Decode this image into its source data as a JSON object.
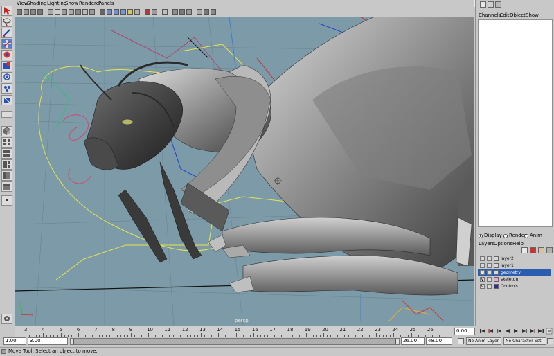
{
  "menubar": {
    "items": [
      "View",
      "Shading",
      "Lighting",
      "Show",
      "Renderer",
      "Panels"
    ]
  },
  "viewport": {
    "camera_label": "persp",
    "background_color": "#7d9aa8"
  },
  "channel_box": {
    "menu": [
      "Channels",
      "Edit",
      "Object",
      "Show"
    ]
  },
  "layer_editor": {
    "mode_options": [
      {
        "label": "Display",
        "selected": true
      },
      {
        "label": "Render",
        "selected": false
      },
      {
        "label": "Anim",
        "selected": false
      }
    ],
    "menu": [
      "Layers",
      "Options",
      "Help"
    ],
    "layers": [
      {
        "name": "layer2",
        "visible_flag": "",
        "color": "#d8d8d8",
        "selected": false
      },
      {
        "name": "layer1",
        "visible_flag": "",
        "color": "#d8d8d8",
        "selected": false
      },
      {
        "name": "geometry",
        "visible_flag": "V",
        "color": "#d8d8d8",
        "selected": true
      },
      {
        "name": "skeleton",
        "visible_flag": "V",
        "color": "#e6a8d8",
        "selected": false
      },
      {
        "name": "Controls",
        "visible_flag": "V",
        "color": "#3a2a8a",
        "selected": false
      }
    ]
  },
  "time_slider": {
    "ticks": [
      "3",
      "4",
      "5",
      "6",
      "7",
      "8",
      "9",
      "10",
      "11",
      "12",
      "13",
      "14",
      "15",
      "16",
      "17",
      "18",
      "19",
      "20",
      "21",
      "22",
      "23",
      "24",
      "25",
      "26"
    ],
    "current_frame": "0.00"
  },
  "range_slider": {
    "start_time": "1.00",
    "range_start": "3.00",
    "range_end": "26.00",
    "end_time": "48.00",
    "anim_layer": "No Anim Layer",
    "character_set": "No Character Set"
  },
  "help_line": {
    "text": "Move Tool: Select an object to move."
  }
}
